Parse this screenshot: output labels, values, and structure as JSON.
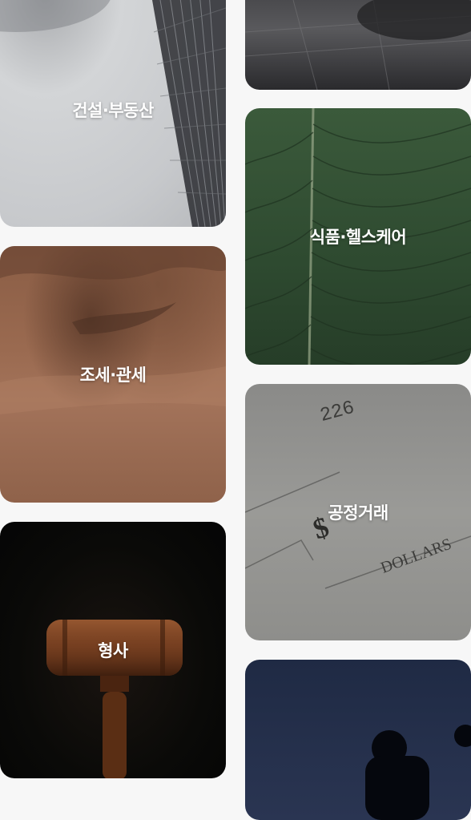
{
  "cards": [
    {
      "id": "construction",
      "label": "건설·부동산"
    },
    {
      "id": "tax",
      "label": "조세·관세"
    },
    {
      "id": "criminal",
      "label": "형사"
    },
    {
      "id": "food",
      "label": "식품·헬스케어"
    },
    {
      "id": "fair",
      "label": "공정거래"
    }
  ],
  "image_text": {
    "check_number": "226",
    "check_dollar_sign": "$",
    "check_dollars": "DOLLARS"
  }
}
